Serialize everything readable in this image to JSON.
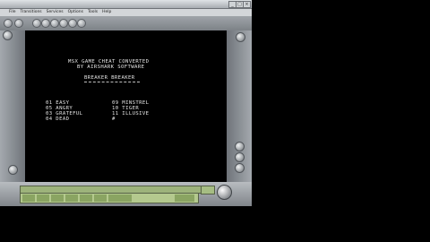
{
  "window": {
    "controls": [
      "_",
      "□",
      "×"
    ]
  },
  "menubar": {
    "items": [
      "File",
      "Transitions",
      "Services",
      "Options",
      "Tools",
      "Help"
    ]
  },
  "screen": {
    "title_lines": [
      "MSX GAME CHEAT CONVERTED",
      "BY AIRSHARK SOFTWARE"
    ],
    "game_title": "BREAKER BREAKER",
    "options": [
      {
        "left": "01 EASY",
        "right": "09 MINSTREL"
      },
      {
        "left": "05 ANGRY",
        "right": "10 TIGER"
      },
      {
        "left": "03 GRATEFUL",
        "right": "11 ILLUSIVE"
      },
      {
        "left": "04 DEAD",
        "right": "#"
      }
    ]
  },
  "colors": {
    "screen_bg": "#000000",
    "text": "#e4e4e4",
    "lcd": "#b4c98e",
    "chrome": "#9ea3a8"
  }
}
